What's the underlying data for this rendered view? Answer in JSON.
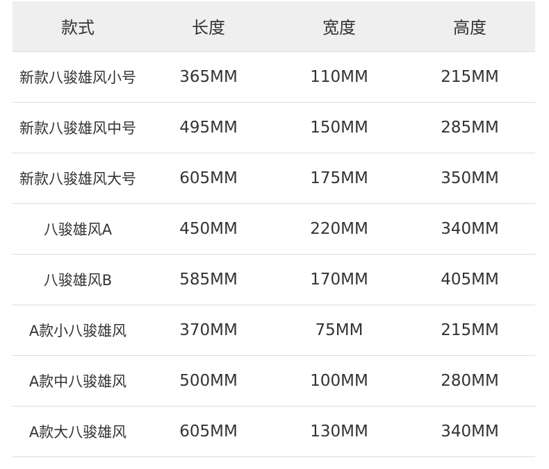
{
  "table": {
    "headers": [
      "款式",
      "长度",
      "宽度",
      "高度"
    ],
    "rows": [
      {
        "name": "新款八骏雄风小号",
        "length": "365MM",
        "width": "110MM",
        "height": "215MM"
      },
      {
        "name": "新款八骏雄风中号",
        "length": "495MM",
        "width": "150MM",
        "height": "285MM"
      },
      {
        "name": "新款八骏雄风大号",
        "length": "605MM",
        "width": "175MM",
        "height": "350MM"
      },
      {
        "name": "八骏雄风A",
        "length": "450MM",
        "width": "220MM",
        "height": "340MM"
      },
      {
        "name": "八骏雄风B",
        "length": "585MM",
        "width": "170MM",
        "height": "405MM"
      },
      {
        "name": "A款小八骏雄风",
        "length": "370MM",
        "width": "75MM",
        "height": "215MM"
      },
      {
        "name": "A款中八骏雄风",
        "length": "500MM",
        "width": "100MM",
        "height": "280MM"
      },
      {
        "name": "A款大八骏雄风",
        "length": "605MM",
        "width": "130MM",
        "height": "340MM"
      }
    ]
  },
  "colors": {
    "header_background": "#efefef",
    "text": "#333333",
    "divider": "#dddddd"
  }
}
